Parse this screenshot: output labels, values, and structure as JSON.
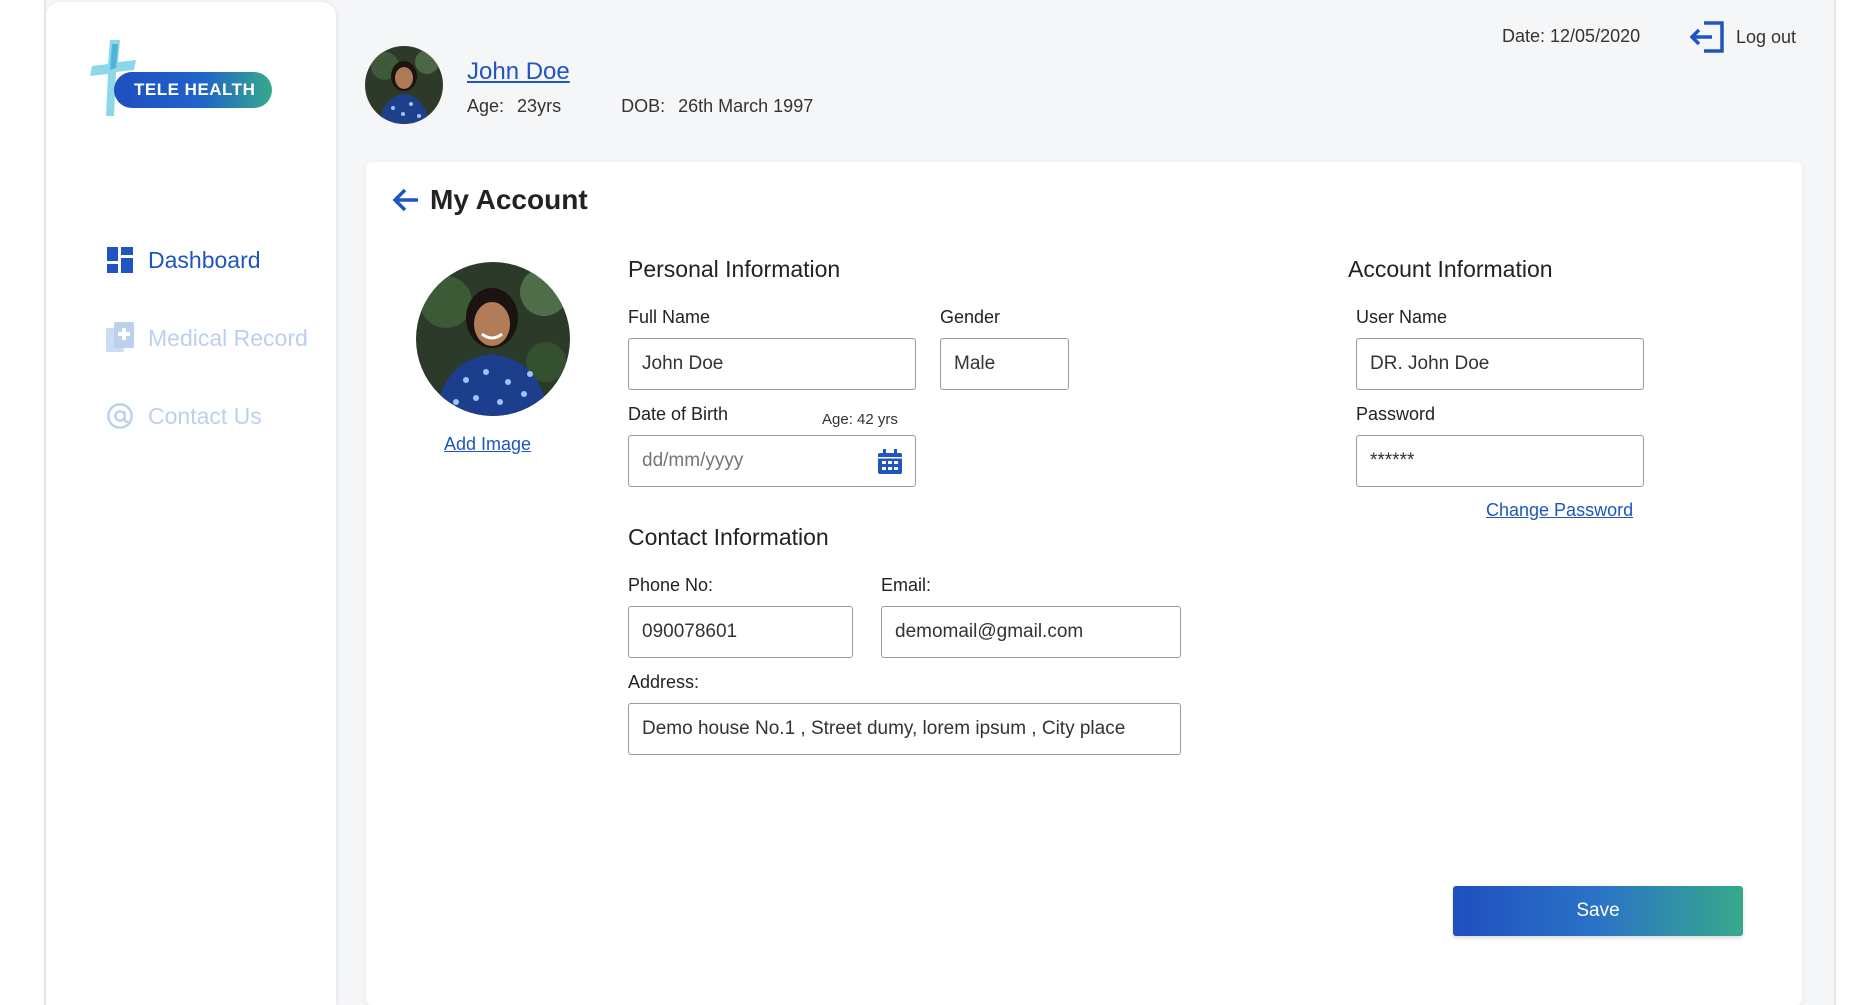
{
  "app": {
    "logo_text": "TELE HEALTH"
  },
  "sidebar": {
    "items": [
      {
        "label": "Dashboard",
        "icon": "dashboard-icon",
        "active": true
      },
      {
        "label": "Medical Record",
        "icon": "medical-record-icon",
        "active": false
      },
      {
        "label": "Contact Us",
        "icon": "at-icon",
        "active": false
      }
    ]
  },
  "header": {
    "user_name": "John Doe",
    "age_label": "Age:",
    "age_value": "23yrs",
    "dob_label": "DOB:",
    "dob_value": "26th March 1997",
    "date_text": "Date: 12/05/2020",
    "logout_label": "Log out"
  },
  "page": {
    "title": "My Account",
    "add_image_label": "Add Image"
  },
  "personal": {
    "title": "Personal Information",
    "full_name_label": "Full Name",
    "full_name_value": "John Doe",
    "gender_label": "Gender",
    "gender_value": "Male",
    "dob_label": "Date of Birth",
    "age_hint": "Age: 42 yrs",
    "dob_placeholder": "dd/mm/yyyy"
  },
  "contact": {
    "title": "Contact Information",
    "phone_label": "Phone No:",
    "phone_value": "090078601",
    "email_label": "Email:",
    "email_value": "demomail@gmail.com",
    "address_label": "Address:",
    "address_value": "Demo house No.1 , Street dumy, lorem ipsum , City place"
  },
  "account": {
    "title": "Account Information",
    "username_label": "User Name",
    "username_value": "DR. John Doe",
    "password_label": "Password",
    "password_value": "******",
    "change_password_label": "Change Password"
  },
  "actions": {
    "save_label": "Save"
  },
  "colors": {
    "primary": "#1f55c0",
    "accent_green": "#36a98a",
    "muted_nav": "#bcd0ee"
  }
}
